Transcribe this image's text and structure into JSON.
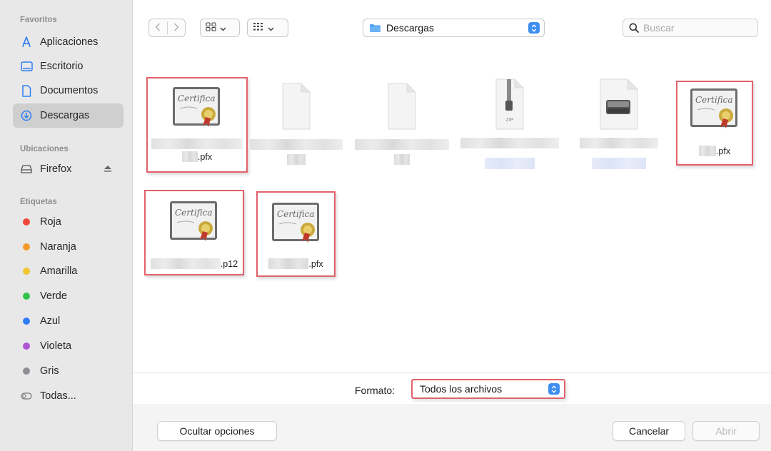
{
  "sidebar": {
    "favorites_heading": "Favoritos",
    "favorites": [
      {
        "label": "Aplicaciones",
        "icon": "applications-icon"
      },
      {
        "label": "Escritorio",
        "icon": "desktop-icon"
      },
      {
        "label": "Documentos",
        "icon": "document-icon"
      },
      {
        "label": "Descargas",
        "icon": "downloads-icon",
        "active": true
      }
    ],
    "locations_heading": "Ubicaciones",
    "locations": [
      {
        "label": "Firefox",
        "icon": "drive-icon",
        "eject_icon": "eject-icon"
      }
    ],
    "tags_heading": "Etiquetas",
    "tags": [
      {
        "label": "Roja",
        "color": "#f0453a"
      },
      {
        "label": "Naranja",
        "color": "#f39a2b"
      },
      {
        "label": "Amarilla",
        "color": "#f2c531"
      },
      {
        "label": "Verde",
        "color": "#34c44c"
      },
      {
        "label": "Azul",
        "color": "#2f7ef5"
      },
      {
        "label": "Violeta",
        "color": "#ad55d3"
      },
      {
        "label": "Gris",
        "color": "#8e8e93"
      }
    ],
    "all_tags": "Todas..."
  },
  "toolbar": {
    "location": "Descargas",
    "search_placeholder": "Buscar"
  },
  "files": [
    {
      "type": "certificate",
      "extension": ".pfx",
      "highlighted": true
    },
    {
      "type": "generic-document",
      "extension": ""
    },
    {
      "type": "generic-document",
      "extension": ""
    },
    {
      "type": "zip-archive",
      "extension": "",
      "icon_text": "ZIP"
    },
    {
      "type": "disk-image",
      "extension": ""
    },
    {
      "type": "certificate",
      "extension": ".pfx",
      "highlighted": true
    },
    {
      "type": "certificate",
      "extension": ".p12",
      "highlighted": true
    },
    {
      "type": "certificate",
      "extension": ".pfx",
      "highlighted": true
    }
  ],
  "format": {
    "label": "Formato:",
    "value": "Todos los archivos"
  },
  "buttons": {
    "hide_options": "Ocultar opciones",
    "cancel": "Cancelar",
    "open": "Abrir"
  },
  "colors": {
    "highlight": "#e2616b",
    "accent": "#3d8ef0"
  }
}
